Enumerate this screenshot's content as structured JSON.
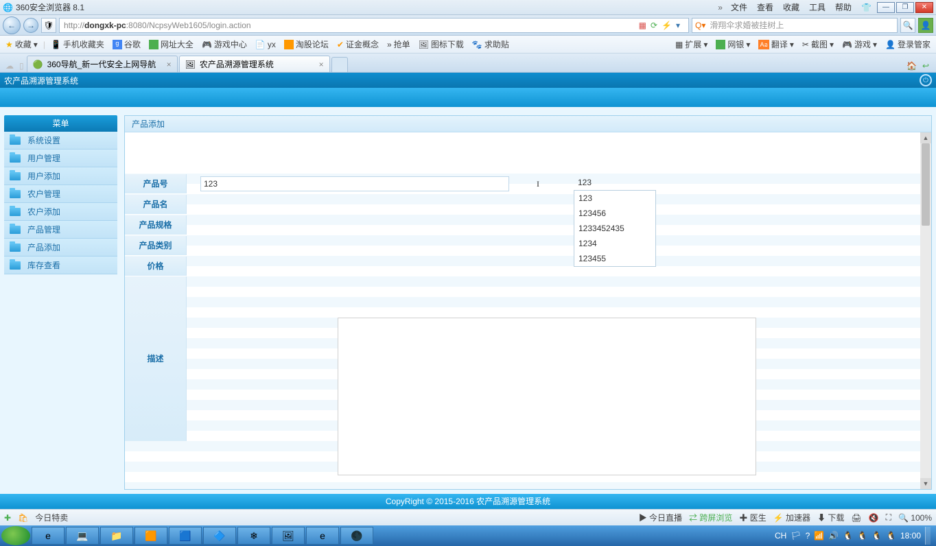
{
  "browser": {
    "title": "360安全浏览器 8.1",
    "menus": [
      "文件",
      "查看",
      "收藏",
      "工具",
      "帮助"
    ],
    "url_prefix": "http://",
    "url_host": "dongxk-pc",
    "url_rest": ":8080/NcpsyWeb1605/login.action",
    "search_placeholder": "滑翔伞求婚被挂树上",
    "fav_label": "收藏",
    "bookmarks": [
      "手机收藏夹",
      "谷歌",
      "网址大全",
      "游戏中心",
      "yx",
      "淘股论坛",
      "证金概念",
      "抢单",
      "图标下载",
      "求助贴"
    ],
    "bookmarks_right": [
      "扩展",
      "网银",
      "翻译",
      "截图",
      "游戏",
      "登录管家"
    ],
    "tabs": [
      {
        "title": "360导航_新一代安全上网导航"
      },
      {
        "title": "农产品溯源管理系统"
      }
    ]
  },
  "app": {
    "title": "农产品溯源管理系统",
    "sidebar_header": "菜单",
    "sidebar": [
      "系统设置",
      "用户管理",
      "用户添加",
      "农户管理",
      "农户添加",
      "产品管理",
      "产品添加",
      "库存查看"
    ],
    "panel_title": "产品添加",
    "form": {
      "product_no_label": "产品号",
      "product_no_value": "123",
      "product_name_label": "产品名",
      "spec_label": "产品规格",
      "category_label": "产品类别",
      "price_label": "价格",
      "desc_label": "描述"
    },
    "suggestions": [
      "123",
      "123456",
      "1233452435",
      "1234",
      "123455"
    ],
    "copyright": "CopyRight © 2015-2016 农产品溯源管理系统"
  },
  "status": {
    "left": [
      "今日特卖"
    ],
    "right": [
      "今日直播",
      "跨屏浏览",
      "医生",
      "加速器",
      "下载",
      "100%"
    ]
  },
  "taskbar": {
    "time": "18:00",
    "ime": "CH"
  }
}
